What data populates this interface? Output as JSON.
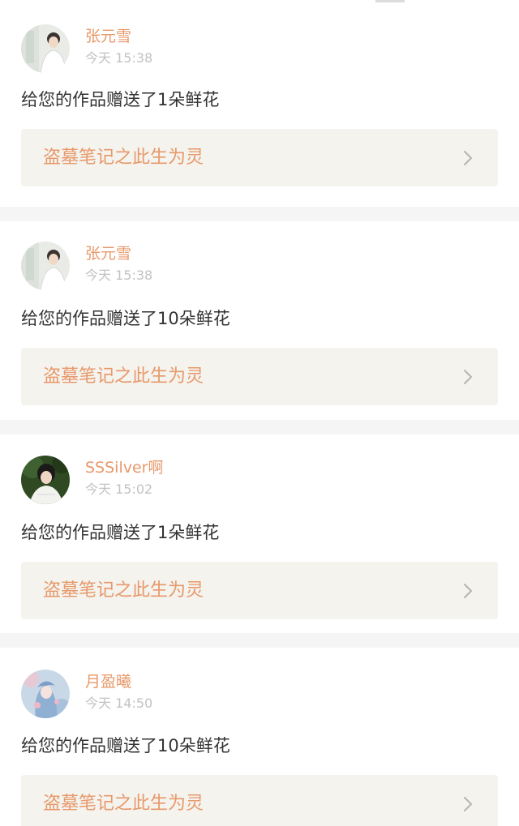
{
  "notifications": [
    {
      "username": "张元雪",
      "time": "今天 15:38",
      "message": "给您的作品赠送了1朵鲜花",
      "work_title": "盗墓笔记之此生为灵",
      "avatar": "avatar-boy-white-shirt"
    },
    {
      "username": "张元雪",
      "time": "今天 15:38",
      "message": "给您的作品赠送了10朵鲜花",
      "work_title": "盗墓笔记之此生为灵",
      "avatar": "avatar-boy-white-shirt"
    },
    {
      "username": "SSSilver啊",
      "time": "今天 15:02",
      "message": "给您的作品赠送了1朵鲜花",
      "work_title": "盗墓笔记之此生为灵",
      "avatar": "avatar-person-green-background"
    },
    {
      "username": "月盈曦",
      "time": "今天 14:50",
      "message": "给您的作品赠送了10朵鲜花",
      "work_title": "盗墓笔记之此生为灵",
      "avatar": "avatar-illustrated-girl-blue"
    }
  ],
  "icons": {
    "chevron": "chevron-right-icon"
  },
  "colors": {
    "accent": "#e8986a",
    "timestamp": "#c2c2c2",
    "message_text": "#333333",
    "work_link_bg": "#f4f3ee",
    "page_bg": "#f5f5f5"
  }
}
